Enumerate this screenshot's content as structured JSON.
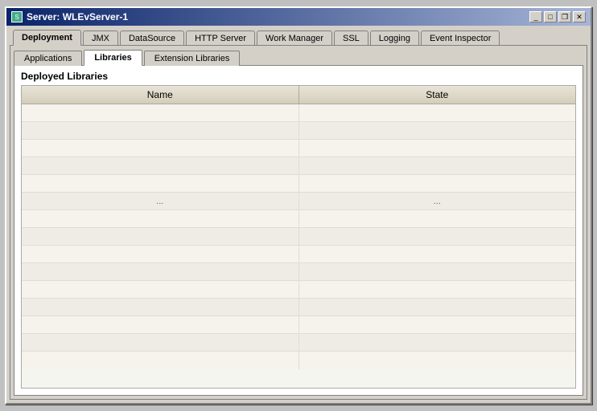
{
  "window": {
    "title": "Server: WLEvServer-1",
    "controls": {
      "minimize": "_",
      "maximize": "□",
      "restore": "❐",
      "close": "✕"
    }
  },
  "primary_tabs": [
    {
      "id": "deployment",
      "label": "Deployment",
      "active": true
    },
    {
      "id": "jmx",
      "label": "JMX",
      "active": false
    },
    {
      "id": "datasource",
      "label": "DataSource",
      "active": false
    },
    {
      "id": "http_server",
      "label": "HTTP Server",
      "active": false
    },
    {
      "id": "work_manager",
      "label": "Work Manager",
      "active": false
    },
    {
      "id": "ssl",
      "label": "SSL",
      "active": false
    },
    {
      "id": "logging",
      "label": "Logging",
      "active": false
    },
    {
      "id": "event_inspector",
      "label": "Event Inspector",
      "active": false
    }
  ],
  "secondary_tabs": [
    {
      "id": "applications",
      "label": "Applications",
      "active": false
    },
    {
      "id": "libraries",
      "label": "Libraries",
      "active": true
    },
    {
      "id": "extension_libraries",
      "label": "Extension Libraries",
      "active": false
    }
  ],
  "section": {
    "title": "Deployed Libraries"
  },
  "table": {
    "columns": [
      "Name",
      "State"
    ],
    "rows": [
      {
        "name": "",
        "state": ""
      },
      {
        "name": "",
        "state": ""
      },
      {
        "name": "",
        "state": ""
      },
      {
        "name": "",
        "state": ""
      },
      {
        "name": "",
        "state": ""
      },
      {
        "name": "...",
        "state": "..."
      },
      {
        "name": "",
        "state": ""
      },
      {
        "name": "",
        "state": ""
      },
      {
        "name": "",
        "state": ""
      },
      {
        "name": "",
        "state": ""
      },
      {
        "name": "",
        "state": ""
      },
      {
        "name": "",
        "state": ""
      },
      {
        "name": "",
        "state": ""
      },
      {
        "name": "",
        "state": ""
      },
      {
        "name": "",
        "state": ""
      }
    ]
  }
}
